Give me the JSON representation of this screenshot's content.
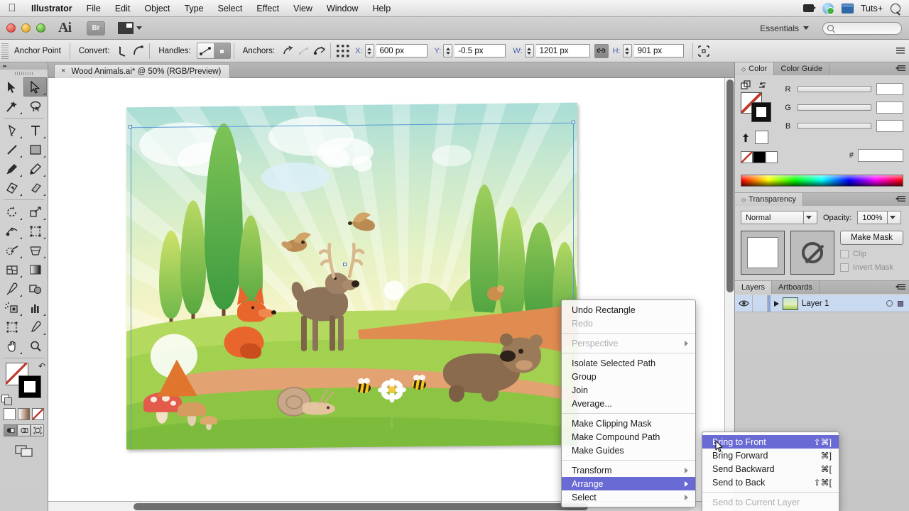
{
  "osbar": {
    "apple_icon": "apple-icon",
    "menus": [
      "Illustrator",
      "File",
      "Edit",
      "Object",
      "Type",
      "Select",
      "Effect",
      "View",
      "Window",
      "Help"
    ],
    "tray": [
      "video-camera-icon",
      "dropbox-icon",
      "window-icon"
    ],
    "account_label": "Tuts+",
    "search_icon": "search-icon"
  },
  "titlebar": {
    "app_logo": "Ai",
    "bridge_label": "Br",
    "arrange_documents_icon": "arrange-documents-icon",
    "workspace": "Essentials",
    "search_placeholder": ""
  },
  "controlbar": {
    "selection_label": "Anchor Point",
    "convert_label": "Convert:",
    "handles_label": "Handles:",
    "anchors_label": "Anchors:",
    "x_label": "X:",
    "x_value": "600 px",
    "y_label": "Y:",
    "y_value": "-0.5 px",
    "w_label": "W:",
    "w_value": "1201 px",
    "h_label": "H:",
    "h_value": "901 px",
    "link_icon": "link-icon",
    "align_icon": "align-icon",
    "overflow_icon": "panel-menu-icon"
  },
  "document": {
    "tab_close": "×",
    "tab_title": "Wood Animals.ai* @ 50% (RGB/Preview)"
  },
  "tools": {
    "collapse_icon": "collapse-panel-icon",
    "items": [
      {
        "name": "selection-tool",
        "selected": false
      },
      {
        "name": "direct-selection-tool",
        "selected": true
      },
      {
        "name": "magic-wand-tool",
        "selected": false
      },
      {
        "name": "lasso-tool",
        "selected": false
      },
      {
        "name": "pen-tool",
        "selected": false
      },
      {
        "name": "type-tool",
        "selected": false
      },
      {
        "name": "line-segment-tool",
        "selected": false
      },
      {
        "name": "rectangle-tool",
        "selected": false
      },
      {
        "name": "paintbrush-tool",
        "selected": false
      },
      {
        "name": "pencil-tool",
        "selected": false
      },
      {
        "name": "blob-brush-tool",
        "selected": false
      },
      {
        "name": "eraser-tool",
        "selected": false
      },
      {
        "name": "rotate-tool",
        "selected": false
      },
      {
        "name": "scale-tool",
        "selected": false
      },
      {
        "name": "width-tool",
        "selected": false
      },
      {
        "name": "free-transform-tool",
        "selected": false
      },
      {
        "name": "shape-builder-tool",
        "selected": false
      },
      {
        "name": "perspective-grid-tool",
        "selected": false
      },
      {
        "name": "mesh-tool",
        "selected": false
      },
      {
        "name": "gradient-tool",
        "selected": false
      },
      {
        "name": "eyedropper-tool",
        "selected": false
      },
      {
        "name": "blend-tool",
        "selected": false
      },
      {
        "name": "symbol-sprayer-tool",
        "selected": false
      },
      {
        "name": "column-graph-tool",
        "selected": false
      },
      {
        "name": "artboard-tool",
        "selected": false
      },
      {
        "name": "slice-tool",
        "selected": false
      },
      {
        "name": "hand-tool",
        "selected": false
      },
      {
        "name": "zoom-tool",
        "selected": false
      }
    ],
    "fill_label": "fill-swatch",
    "stroke_label": "stroke-swatch",
    "swap_icon": "swap-fill-stroke-icon",
    "default_icon": "default-fill-stroke-icon",
    "color_modes": [
      "color-swatch",
      "gradient-swatch",
      "none-swatch"
    ],
    "draw_modes": [
      "draw-normal",
      "draw-behind",
      "draw-inside"
    ],
    "screen_mode": "change-screen-mode-icon"
  },
  "color_panel": {
    "tabs": [
      "Color",
      "Color Guide"
    ],
    "active_tab": "Color",
    "channels": [
      {
        "label": "R",
        "value": ""
      },
      {
        "label": "G",
        "value": ""
      },
      {
        "label": "B",
        "value": ""
      }
    ],
    "hex_label": "#",
    "hex_value": "",
    "menu_icon": "panel-menu-icon"
  },
  "transparency_panel": {
    "title": "Transparency",
    "blend_mode": "Normal",
    "opacity_label": "Opacity:",
    "opacity_value": "100%",
    "make_mask_label": "Make Mask",
    "clip_label": "Clip",
    "invert_mask_label": "Invert Mask",
    "menu_icon": "panel-menu-icon"
  },
  "layers_panel": {
    "tabs": [
      "Layers",
      "Artboards"
    ],
    "active_tab": "Layers",
    "rows": [
      {
        "name": "Layer 1",
        "visible": true,
        "selected": true
      }
    ],
    "menu_icon": "panel-menu-icon"
  },
  "context_menu": {
    "items": [
      {
        "label": "Undo Rectangle",
        "type": "item",
        "disabled": false
      },
      {
        "label": "Redo",
        "type": "item",
        "disabled": true
      },
      {
        "type": "separator"
      },
      {
        "label": "Perspective",
        "type": "submenu",
        "disabled": true
      },
      {
        "type": "separator"
      },
      {
        "label": "Isolate Selected Path",
        "type": "item",
        "disabled": false
      },
      {
        "label": "Group",
        "type": "item",
        "disabled": false
      },
      {
        "label": "Join",
        "type": "item",
        "disabled": false
      },
      {
        "label": "Average...",
        "type": "item",
        "disabled": false
      },
      {
        "type": "separator"
      },
      {
        "label": "Make Clipping Mask",
        "type": "item",
        "disabled": false
      },
      {
        "label": "Make Compound Path",
        "type": "item",
        "disabled": false
      },
      {
        "label": "Make Guides",
        "type": "item",
        "disabled": false
      },
      {
        "type": "separator"
      },
      {
        "label": "Transform",
        "type": "submenu",
        "disabled": false
      },
      {
        "label": "Arrange",
        "type": "submenu",
        "disabled": false,
        "highlighted": true
      },
      {
        "label": "Select",
        "type": "submenu",
        "disabled": false
      }
    ]
  },
  "arrange_submenu": {
    "items": [
      {
        "label": "Bring to Front",
        "shortcut": "⇧⌘]",
        "highlighted": true,
        "disabled": false
      },
      {
        "label": "Bring Forward",
        "shortcut": "⌘]",
        "highlighted": false,
        "disabled": false
      },
      {
        "label": "Send Backward",
        "shortcut": "⌘[",
        "highlighted": false,
        "disabled": false
      },
      {
        "label": "Send to Back",
        "shortcut": "⇧⌘[",
        "highlighted": false,
        "disabled": false
      },
      {
        "type": "separator"
      },
      {
        "label": "Send to Current Layer",
        "shortcut": "",
        "highlighted": false,
        "disabled": true
      }
    ]
  },
  "artwork": {
    "title": "Wood Animals illustration",
    "elements": [
      "sky",
      "sun-rays",
      "clouds",
      "trees",
      "hills",
      "path",
      "deer",
      "fox",
      "bear",
      "snail",
      "bees",
      "daisy",
      "mushrooms",
      "birds"
    ]
  },
  "colors": {
    "highlight": "#6a6ad4",
    "panel_bg": "#d2d2d2",
    "chrome": "#cbcbcb",
    "layer_selected": "#c8d9f0"
  }
}
